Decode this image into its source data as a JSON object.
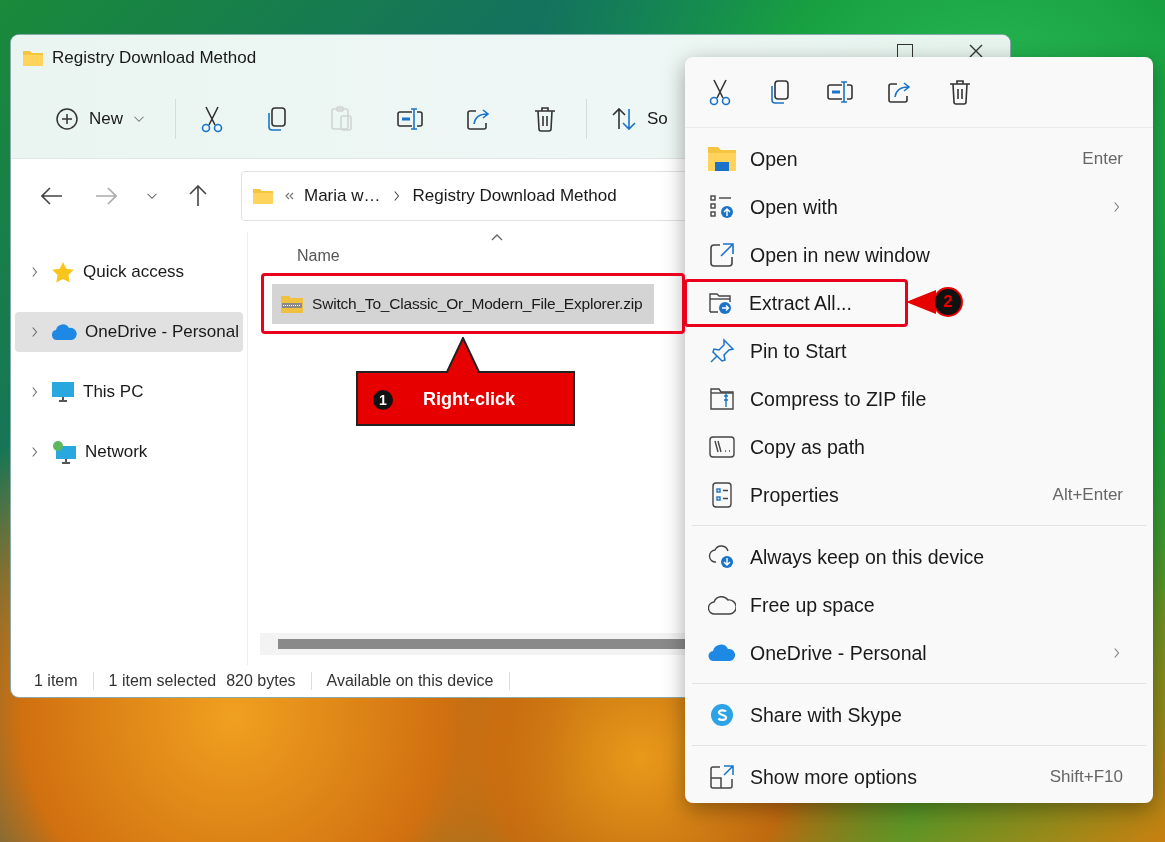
{
  "window": {
    "title": "Registry Download Method"
  },
  "toolbar": {
    "buttons": [
      {
        "kind": "new",
        "label": "New",
        "disabled": false
      },
      {
        "kind": "cut",
        "disabled": false
      },
      {
        "kind": "copy",
        "disabled": false
      },
      {
        "kind": "paste",
        "disabled": true
      },
      {
        "kind": "rename",
        "disabled": false
      },
      {
        "kind": "share",
        "disabled": false
      },
      {
        "kind": "delete",
        "disabled": false
      },
      {
        "kind": "sort",
        "label": "So",
        "disabled": false
      }
    ]
  },
  "address_bar": {
    "forward_disabled": true,
    "path": [
      "Maria w…",
      "Registry Download Method"
    ]
  },
  "nav_pane": {
    "items": [
      {
        "kind": "star",
        "label": "Quick access",
        "selected": false
      },
      {
        "kind": "cloud",
        "label": "OneDrive - Personal",
        "selected": true
      },
      {
        "kind": "pc",
        "label": "This PC",
        "selected": false
      },
      {
        "kind": "network",
        "label": "Network",
        "selected": false
      }
    ]
  },
  "files": {
    "columns": [
      "Name"
    ],
    "rows": [
      {
        "name": "Switch_To_Classic_Or_Modern_File_Explorer.zip",
        "selected": true
      }
    ]
  },
  "status_bar": [
    "1 item",
    "1 item selected",
    "820 bytes",
    "Available on this device"
  ],
  "context_menu": {
    "items": [
      {
        "kind": "open",
        "label": "Open",
        "shortcut": "Enter",
        "submenu": false,
        "highlighted": false
      },
      {
        "kind": "open-with",
        "label": "Open with",
        "submenu": true,
        "highlighted": false
      },
      {
        "kind": "new-window",
        "label": "Open in new window",
        "submenu": false,
        "highlighted": false
      },
      {
        "kind": "extract",
        "label": "Extract All...",
        "submenu": false,
        "highlighted": true
      },
      {
        "kind": "pin",
        "label": "Pin to Start",
        "submenu": false,
        "highlighted": false
      },
      {
        "kind": "compress",
        "label": "Compress to ZIP file",
        "submenu": false,
        "highlighted": false
      },
      {
        "kind": "path",
        "label": "Copy as path",
        "submenu": false,
        "highlighted": false
      },
      {
        "kind": "properties",
        "label": "Properties",
        "shortcut": "Alt+Enter",
        "submenu": false,
        "highlighted": false
      },
      {
        "kind": "separator"
      },
      {
        "kind": "keep",
        "label": "Always keep on this device",
        "submenu": false,
        "highlighted": false
      },
      {
        "kind": "free",
        "label": "Free up space",
        "submenu": false,
        "highlighted": false
      },
      {
        "kind": "onedrive",
        "label": "OneDrive - Personal",
        "submenu": true,
        "highlighted": false
      },
      {
        "kind": "separator"
      },
      {
        "kind": "skype",
        "label": "Share with Skype",
        "submenu": false,
        "highlighted": false
      },
      {
        "kind": "separator"
      },
      {
        "kind": "more",
        "label": "Show more options",
        "shortcut": "Shift+F10",
        "submenu": false,
        "highlighted": false
      }
    ]
  },
  "annotations": [
    {
      "kind": "callout",
      "number": "1",
      "label": "Right-click"
    },
    {
      "kind": "badge",
      "number": "2"
    }
  ]
}
